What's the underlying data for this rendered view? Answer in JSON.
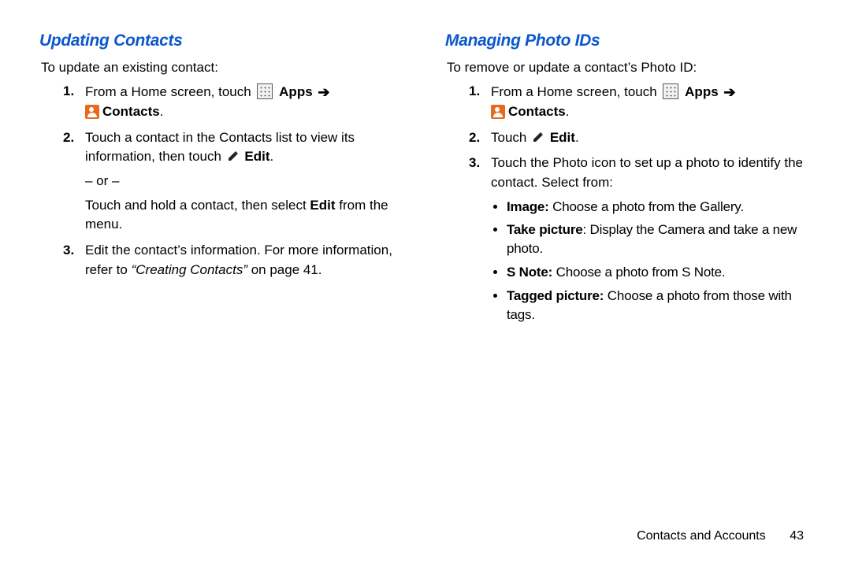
{
  "left": {
    "heading": "Updating Contacts",
    "intro": "To update an existing contact:",
    "step1_pre": "From a Home screen, touch ",
    "apps_label": "Apps",
    "contacts_label": "Contacts",
    "step2_a": "Touch a contact in the Contacts list to view its information, then touch ",
    "edit_label": "Edit",
    "or": "– or –",
    "step2_b_a": "Touch and hold a contact, then select ",
    "step2_b_b": " from the menu.",
    "step3_a": "Edit the contact’s information. For more information, refer to ",
    "step3_ref": "“Creating Contacts”",
    "step3_b": "  on page 41."
  },
  "right": {
    "heading": "Managing Photo IDs",
    "intro": "To remove or update a contact’s Photo ID:",
    "step1_pre": "From a Home screen, touch ",
    "apps_label": "Apps",
    "contacts_label": "Contacts",
    "step2_pre": "Touch ",
    "edit_label": "Edit",
    "step3": "Touch the Photo icon to set up a photo to identify the contact. Select from:",
    "b1_t": "Image:",
    "b1_d": " Choose a photo from the Gallery.",
    "b2_t": "Take picture",
    "b2_d": ": Display the Camera and take a new photo.",
    "b3_t": "S Note:",
    "b3_d": " Choose a photo from S Note.",
    "b4_t": "Tagged picture:",
    "b4_d": " Choose a photo from those with tags."
  },
  "footer": {
    "section": "Contacts and Accounts",
    "page": "43"
  }
}
